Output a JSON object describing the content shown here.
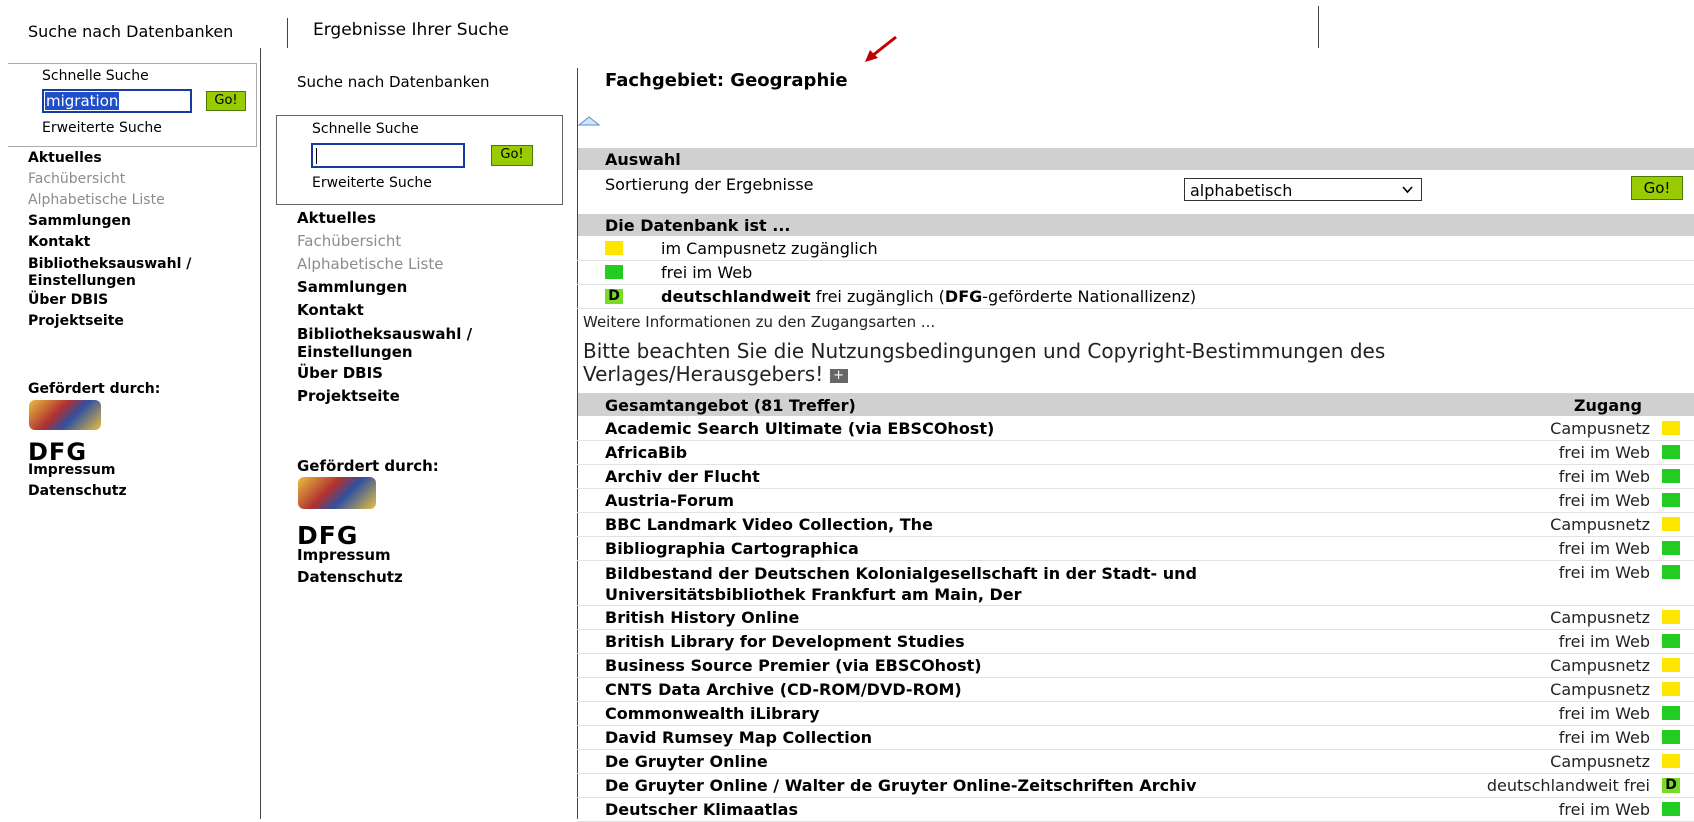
{
  "top": {
    "left_title": "Suche nach Datenbanken",
    "center_title": "Ergebnisse Ihrer Suche"
  },
  "outer_sidebar": {
    "quick_search_label": "Schnelle Suche",
    "search_value": "migration",
    "go_label": "Go!",
    "advanced_label": "Erweiterte Suche",
    "items": [
      {
        "label": "Aktuelles",
        "style": "bold"
      },
      {
        "label": "Fachübersicht",
        "style": "grey"
      },
      {
        "label": "Alphabetische Liste",
        "style": "grey"
      },
      {
        "label": "Sammlungen",
        "style": "bold"
      },
      {
        "label": "Kontakt",
        "style": "bold"
      },
      {
        "label": "Bibliotheksauswahl /",
        "style": "bold"
      },
      {
        "label": "Einstellungen",
        "style": "bold"
      },
      {
        "label": "Über DBIS",
        "style": "bold"
      },
      {
        "label": "Projektseite",
        "style": "bold"
      }
    ],
    "funded_by": "Gefördert durch:",
    "dfg": "DFG",
    "impressum": "Impressum",
    "datenschutz": "Datenschutz"
  },
  "inner_sidebar": {
    "title": "Suche nach Datenbanken",
    "quick_search_label": "Schnelle Suche",
    "search_value": "",
    "go_label": "Go!",
    "advanced_label": "Erweiterte Suche",
    "items": [
      {
        "label": "Aktuelles",
        "style": "bold"
      },
      {
        "label": "Fachübersicht",
        "style": "grey"
      },
      {
        "label": "Alphabetische Liste",
        "style": "grey"
      },
      {
        "label": "Sammlungen",
        "style": "bold"
      },
      {
        "label": "Kontakt",
        "style": "bold"
      },
      {
        "label": "Bibliotheksauswahl /",
        "style": "bold"
      },
      {
        "label": "Einstellungen",
        "style": "bold"
      },
      {
        "label": "Über DBIS",
        "style": "bold"
      },
      {
        "label": "Projektseite",
        "style": "bold"
      }
    ],
    "funded_by": "Gefördert durch:",
    "dfg": "DFG",
    "impressum": "Impressum",
    "datenschutz": "Datenschutz"
  },
  "main": {
    "subject": "Fachgebiet: Geographie",
    "selection_header": "Auswahl",
    "sort_label": "Sortierung der Ergebnisse",
    "sort_value": "alphabetisch",
    "go_label": "Go!",
    "db_header": "Die Datenbank ist ...",
    "legend_campus": "im Campusnetz zugänglich",
    "legend_web": "frei im Web",
    "legend_d_badge": "D",
    "legend_de_bold1": "deutschlandweit",
    "legend_de_text1": " frei zugänglich (",
    "legend_de_bold2": "DFG",
    "legend_de_text2": "-geförderte Nationallizenz)",
    "more_info": "Weitere Informationen zu den Zugangsarten ...",
    "notice_line1": "Bitte beachten Sie die Nutzungsbedingungen und Copyright-Bestimmungen des",
    "notice_line2": "Verlages/Herausgebers!",
    "results_header": "Gesamtangebot (81 Treffer)",
    "access_header": "Zugang",
    "results": [
      {
        "name": "Academic Search Ultimate (via EBSCOhost)",
        "access": "Campusnetz",
        "kind": "yellow"
      },
      {
        "name": "AfricaBib",
        "access": "frei im Web",
        "kind": "green"
      },
      {
        "name": "Archiv der Flucht",
        "access": "frei im Web",
        "kind": "green"
      },
      {
        "name": "Austria-Forum",
        "access": "frei im Web",
        "kind": "green"
      },
      {
        "name": "BBC Landmark Video Collection, The",
        "access": "Campusnetz",
        "kind": "yellow"
      },
      {
        "name": "Bibliographia Cartographica",
        "access": "frei im Web",
        "kind": "green"
      },
      {
        "name": "Bildbestand der Deutschen Kolonialgesellschaft in der Stadt- und",
        "name2": "Universitätsbibliothek Frankfurt am Main, Der",
        "access": "frei im Web",
        "kind": "green"
      },
      {
        "name": "British History Online",
        "access": "Campusnetz",
        "kind": "yellow"
      },
      {
        "name": "British Library for Development Studies",
        "access": "frei im Web",
        "kind": "green"
      },
      {
        "name": "Business Source Premier (via EBSCOhost)",
        "access": "Campusnetz",
        "kind": "yellow"
      },
      {
        "name": "CNTS Data Archive (CD-ROM/DVD-ROM)",
        "access": "Campusnetz",
        "kind": "yellow"
      },
      {
        "name": "Commonwealth iLibrary",
        "access": "frei im Web",
        "kind": "green"
      },
      {
        "name": "David Rumsey Map Collection",
        "access": "frei im Web",
        "kind": "green"
      },
      {
        "name": "De Gruyter Online",
        "access": "Campusnetz",
        "kind": "yellow"
      },
      {
        "name": "De Gruyter Online / Walter de Gruyter Online-Zeitschriften Archiv",
        "access": "deutschlandweit frei",
        "kind": "D"
      },
      {
        "name": "Deutscher Klimaatlas",
        "access": "frei im Web",
        "kind": "green"
      }
    ],
    "colors": {
      "campus": "#ffe600",
      "web": "#22cc22",
      "de": "#77dd22",
      "arrow": "#c00000",
      "header_bar": "#d0d0d0"
    }
  }
}
